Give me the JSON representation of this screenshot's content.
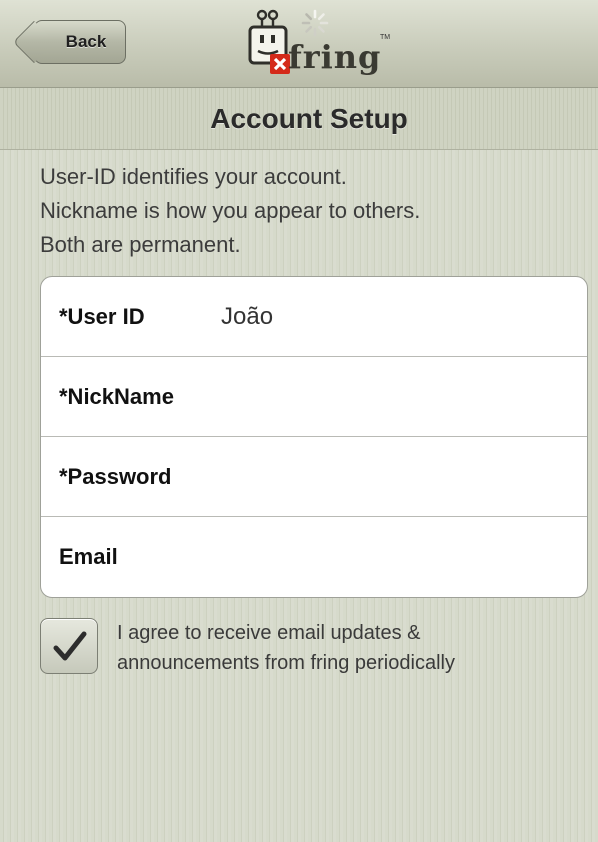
{
  "navbar": {
    "back_label": "Back",
    "logo_text": "fring",
    "logo_tm": "TM"
  },
  "title": "Account Setup",
  "description": [
    "User-ID identifies your account.",
    "Nickname is how you appear to others.",
    "Both are permanent."
  ],
  "form": {
    "fields": [
      {
        "label": "*User ID",
        "value": "João"
      },
      {
        "label": "*NickName",
        "value": ""
      },
      {
        "label": "*Password",
        "value": ""
      },
      {
        "label": "Email",
        "value": ""
      }
    ]
  },
  "agree": {
    "checked": true,
    "lines": [
      "I agree to receive email updates &",
      "announcements from fring periodically"
    ]
  },
  "colors": {
    "background": "#d4d8c8",
    "navbar": "#c9ccbb",
    "logo_red": "#d42a1a"
  },
  "icons": {
    "back": "chevron-left-icon",
    "logo": "fring-robot-logo",
    "spinner": "loading-spinner-icon",
    "check": "checkmark-icon"
  }
}
